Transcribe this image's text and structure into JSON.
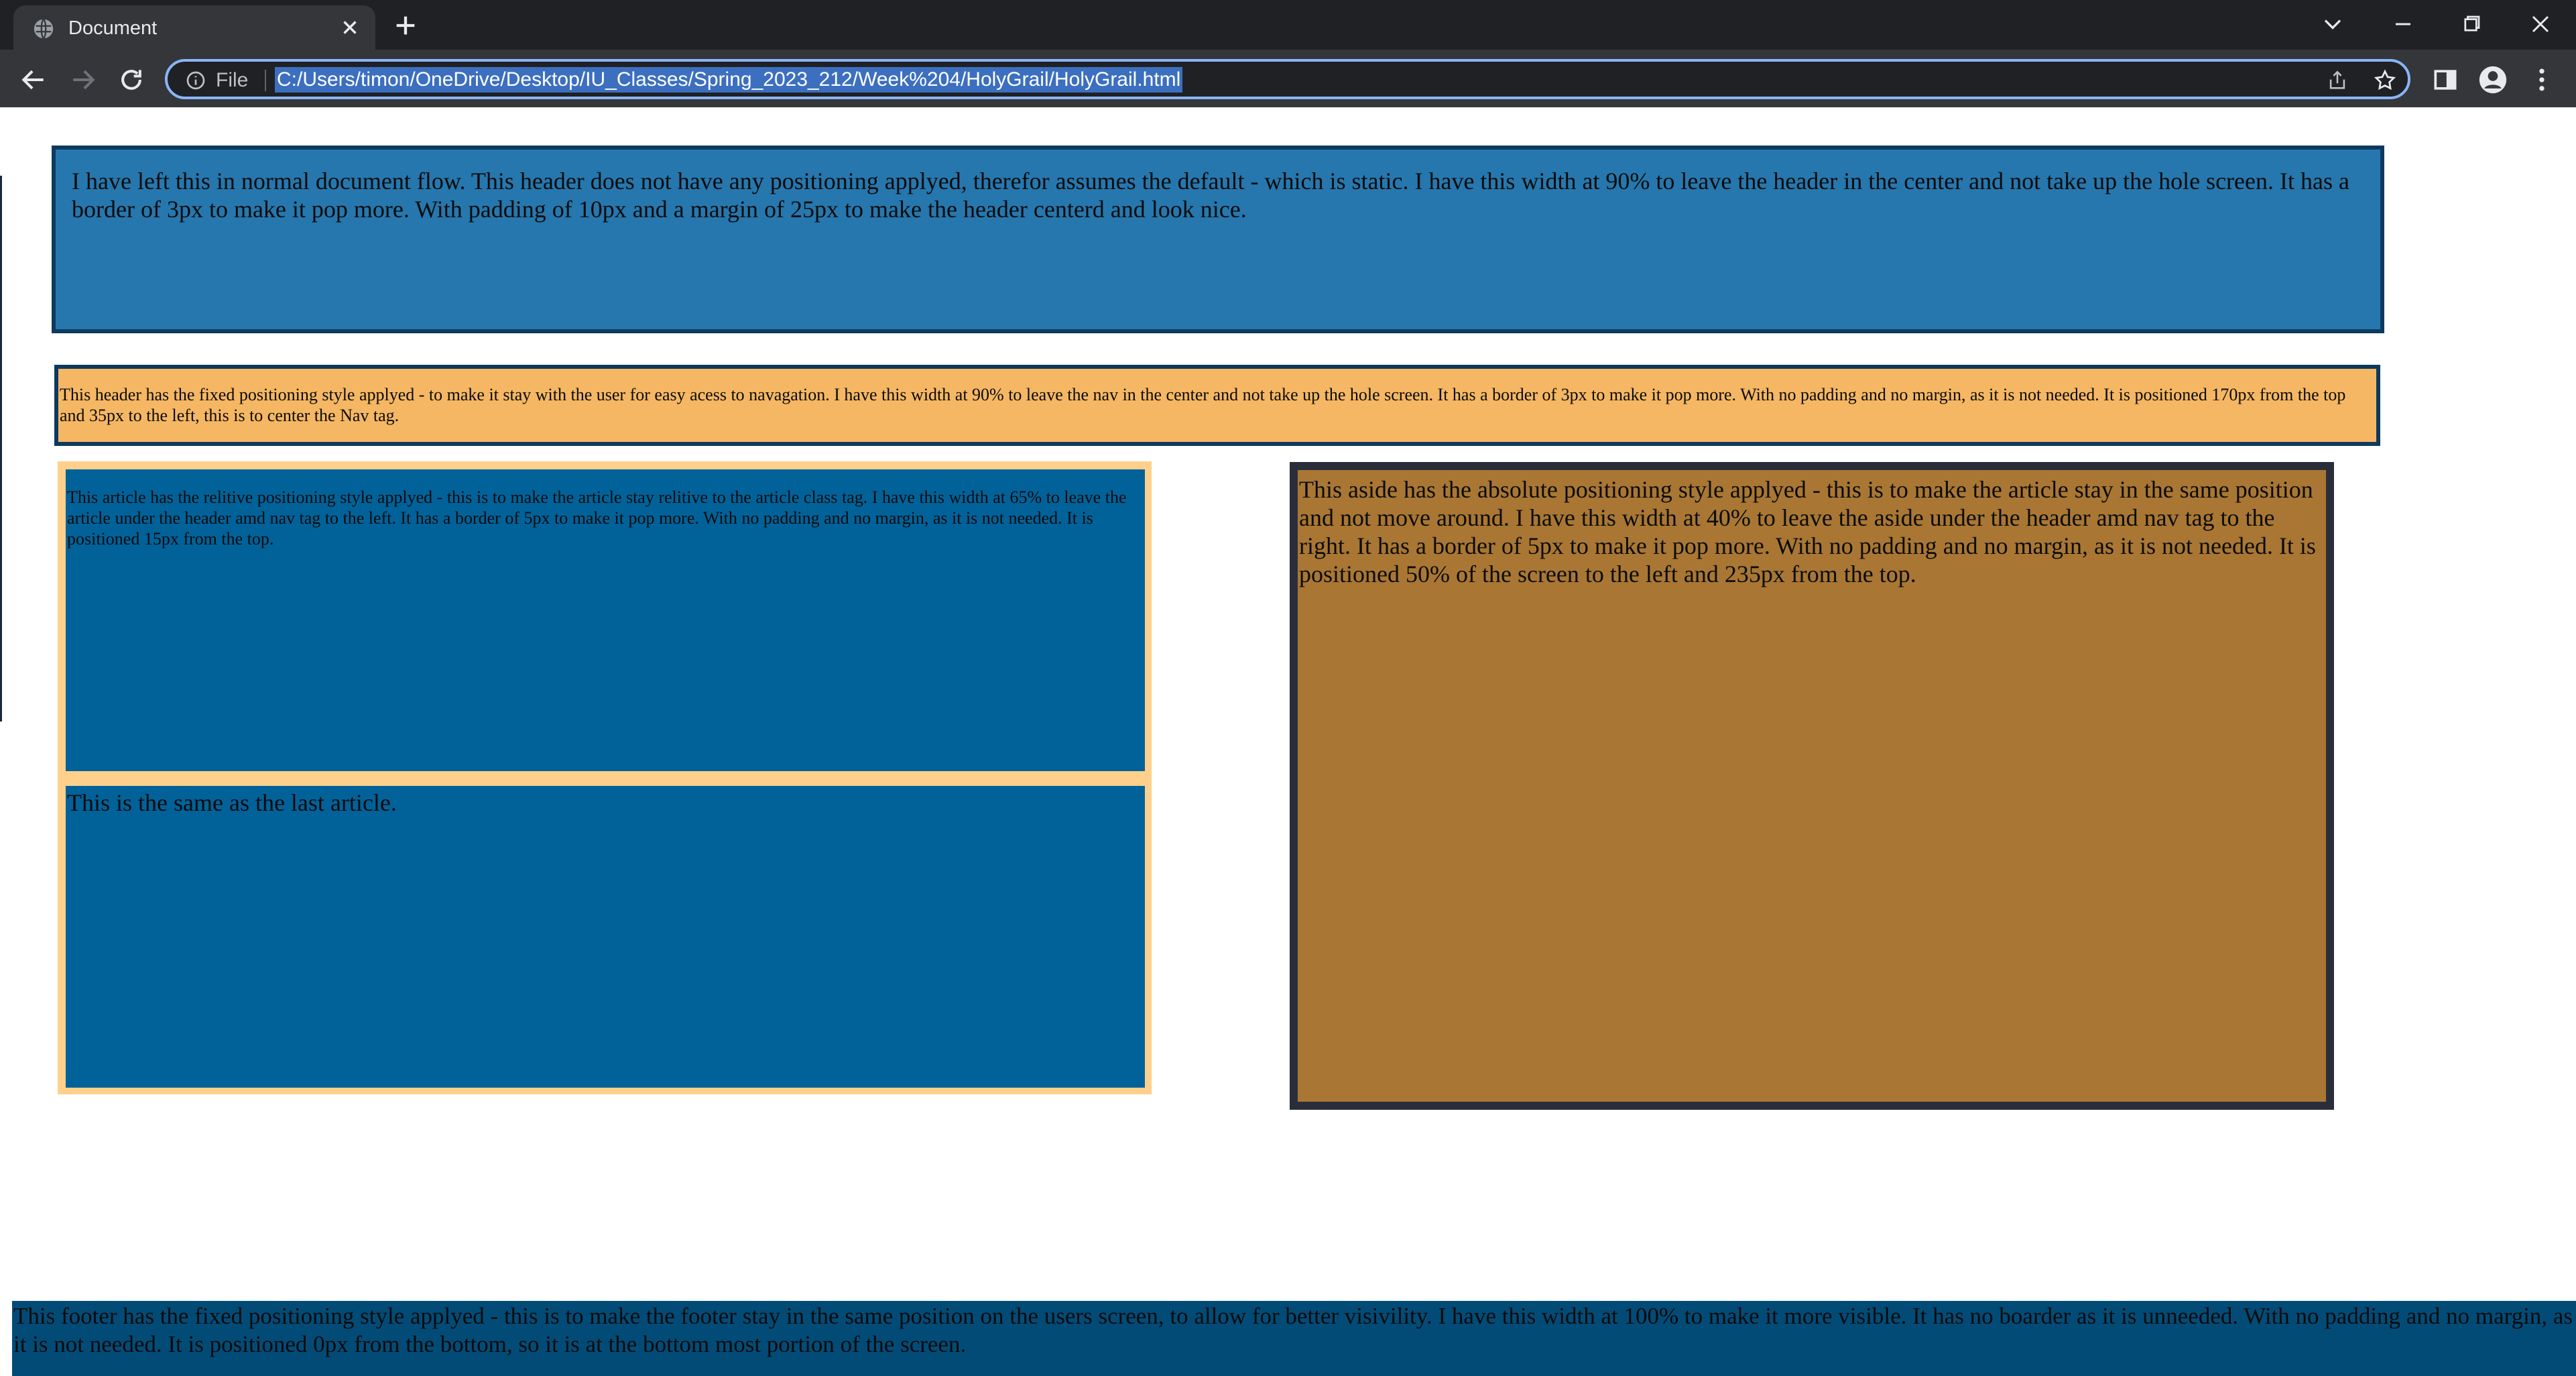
{
  "browser": {
    "tab": {
      "title": "Document"
    },
    "address_bar": {
      "scheme_label": "File",
      "url": "C:/Users/timon/OneDrive/Desktop/IU_Classes/Spring_2023_212/Week%204/HolyGrail/HolyGrail.html"
    },
    "icons": [
      "globe-icon",
      "close-icon",
      "plus-icon",
      "chevron-down-icon",
      "minimize-icon",
      "restore-icon",
      "close-window-icon",
      "back-icon",
      "forward-icon",
      "reload-icon",
      "info-icon",
      "share-icon",
      "star-icon",
      "side-panel-icon",
      "profile-icon",
      "menu-icon"
    ],
    "colors": {
      "chrome": "#202124",
      "toolbar": "#35363a",
      "focus_ring": "#8ab4f8"
    }
  },
  "page": {
    "header": {
      "text": "I have left this in normal document flow. This header does not have any positioning applyed, therefor assumes the default - which is static. I have this width at 90% to leave the header in the center and not take up the hole screen. It has a border of 3px to make it pop more. With padding of 10px and a margin of 25px to make the header centerd and look nice."
    },
    "nav": {
      "text": "This header has the fixed positioning style applyed - to make it stay with the user for easy acess to navagation. I have this width at 90% to leave the nav in the center and not take up the hole screen. It has a border of 3px to make it pop more. With no padding and no margin, as it is not needed. It is positioned 170px from the top and 35px to the left, this is to center the Nav tag."
    },
    "articles": [
      {
        "text": "This article has the relitive positioning style applyed - this is to make the article stay relitive to the article class tag. I have this width at 65% to leave the article under the header amd nav tag to the left. It has a border of 5px to make it pop more. With no padding and no margin, as it is not needed. It is positioned 15px from the top."
      },
      {
        "text": "This is the same as the last article."
      }
    ],
    "aside": {
      "text": "This aside has the absolute positioning style applyed - this is to make the article stay in the same position and not move around. I have this width at 40% to leave the aside under the header amd nav tag to the right. It has a border of 5px to make it pop more. With no padding and no margin, as it is not needed. It is positioned 50% of the screen to the left and 235px from the top."
    },
    "footer": {
      "text": "This footer has the fixed positioning style applyed - this is to make the footer stay in the same position on the users screen, to allow for better visivility. I have this width at 100% to make it more visible. It has no boarder as it is unneeded. With no padding and no margin, as it is not needed. It is positioned 0px from the bottom, so it is at the bottom most portion of the screen."
    },
    "colors": {
      "header_bg": "#2677ae",
      "nav_bg": "#f5b763",
      "article_bg": "#01629a",
      "article_border": "#ffd08c",
      "aside_bg": "#a97733",
      "aside_border": "#2a2e3a",
      "footer_bg": "#034b77"
    }
  }
}
